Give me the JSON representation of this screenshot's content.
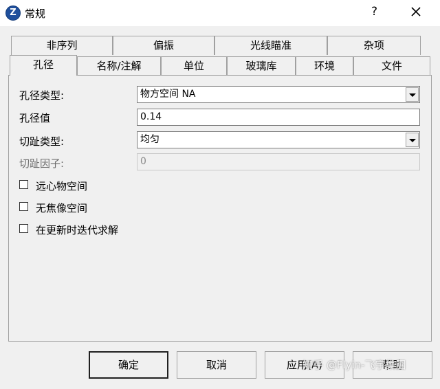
{
  "window": {
    "title": "常规",
    "help_label": "?",
    "app_icon_glyph": "Z",
    "app_icon_name": "zemax-logo-icon",
    "close_icon_name": "close-icon"
  },
  "tabs": {
    "back_row": [
      "非序列",
      "偏振",
      "光线瞄准",
      "杂项"
    ],
    "front_row": [
      "孔径",
      "名称/注解",
      "单位",
      "玻璃库",
      "环境",
      "文件"
    ],
    "active": "孔径"
  },
  "form": {
    "aperture_type": {
      "label": "孔径类型:",
      "value": "物方空间 NA"
    },
    "aperture_value": {
      "label": "孔径值",
      "value": "0.14"
    },
    "apodization_type": {
      "label": "切趾类型:",
      "value": "均匀"
    },
    "apodization_factor": {
      "label": "切趾因子:",
      "value": "0"
    }
  },
  "checkboxes": {
    "telecentric": {
      "label": "远心物空间",
      "checked": false
    },
    "afocal": {
      "label": "无焦像空间",
      "checked": false
    },
    "iterate": {
      "label": "在更新时迭代求解",
      "checked": false
    }
  },
  "buttons": {
    "ok": "确定",
    "cancel": "取消",
    "apply": "应用(A)",
    "help": "帮助"
  },
  "watermark": "知乎 @Flyin-飞宇集團"
}
